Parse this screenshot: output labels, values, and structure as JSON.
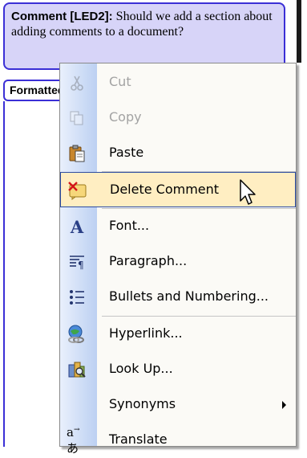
{
  "comment": {
    "author_label": "Comment [LED2]:",
    "text": " Should we add a section about adding comments to a document?"
  },
  "format_balloon": {
    "label": "Formatted"
  },
  "menu": {
    "items": [
      {
        "label": "Cut",
        "icon": "scissors-icon",
        "enabled": false
      },
      {
        "label": "Copy",
        "icon": "copy-icon",
        "enabled": false
      },
      {
        "label": "Paste",
        "icon": "paste-icon",
        "enabled": true
      },
      {
        "label": "Delete Comment",
        "icon": "delete-comment-icon",
        "enabled": true,
        "highlighted": true
      },
      {
        "label": "Font...",
        "icon": "font-icon",
        "enabled": true
      },
      {
        "label": "Paragraph...",
        "icon": "paragraph-icon",
        "enabled": true
      },
      {
        "label": "Bullets and Numbering...",
        "icon": "bullets-icon",
        "enabled": true
      },
      {
        "label": "Hyperlink...",
        "icon": "hyperlink-icon",
        "enabled": true
      },
      {
        "label": "Look Up...",
        "icon": "research-icon",
        "enabled": true
      },
      {
        "label": "Synonyms",
        "icon": "",
        "enabled": true,
        "submenu": true
      },
      {
        "label": "Translate",
        "icon": "translate-icon",
        "enabled": true
      }
    ]
  },
  "colors": {
    "balloon_fill": "#d7d4f8",
    "balloon_border": "#3b2fd6",
    "highlight_fill": "#ffeec2",
    "highlight_border": "#2c4ca3"
  }
}
